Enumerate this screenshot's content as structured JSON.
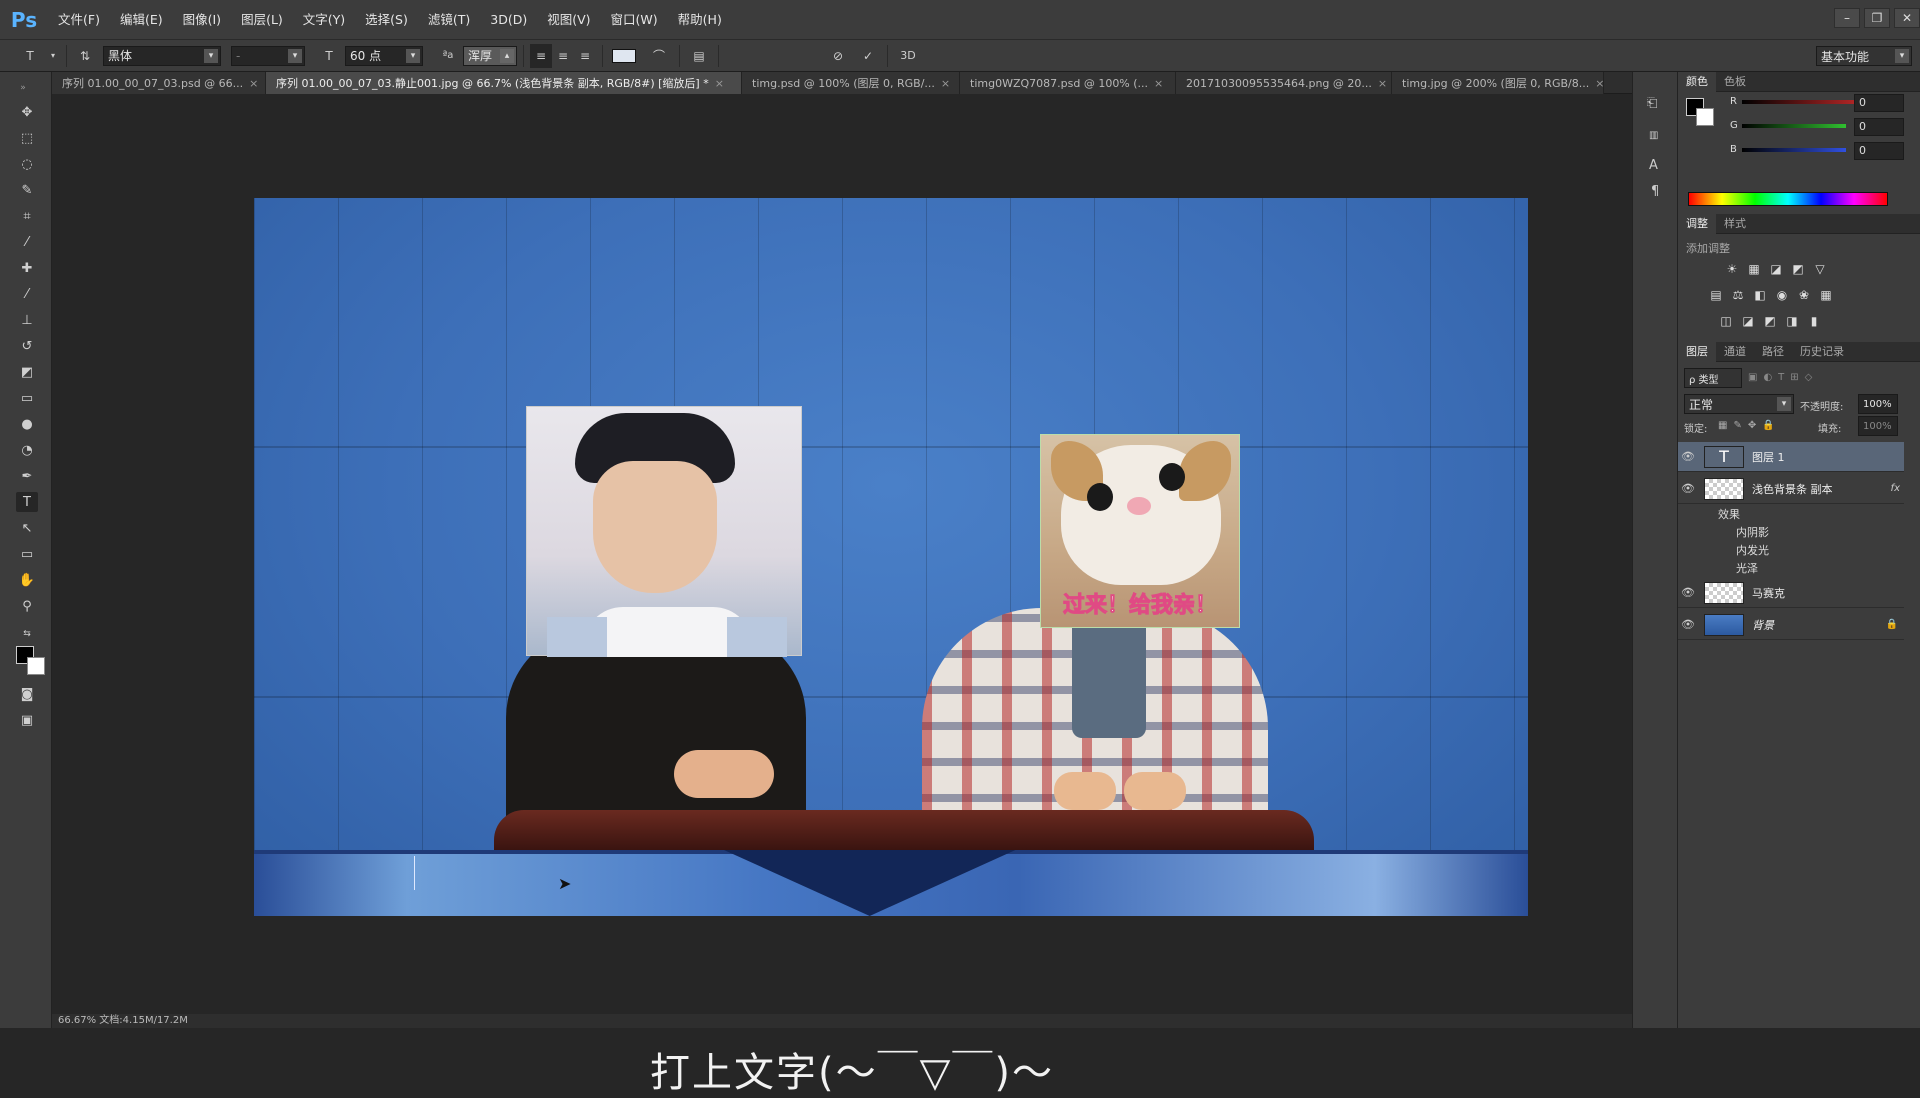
{
  "app": {
    "logo": "Ps"
  },
  "menu": [
    "文件(F)",
    "编辑(E)",
    "图像(I)",
    "图层(L)",
    "文字(Y)",
    "选择(S)",
    "滤镜(T)",
    "3D(D)",
    "视图(V)",
    "窗口(W)",
    "帮助(H)"
  ],
  "window_controls": [
    "–",
    "❐",
    "✕"
  ],
  "options": {
    "font_family": "黑体",
    "font_style": "-",
    "font_size": "60 点",
    "aa_icon": "ªa",
    "antialias": "浑厚",
    "workspace": "基本功能",
    "threed": "3D"
  },
  "tabs": [
    {
      "label": "序列 01.00_00_07_03.psd @ 66...",
      "active": false
    },
    {
      "label": "序列 01.00_00_07_03.静止001.jpg @ 66.7% (浅色背景条 副本, RGB/8#) [缩放后] *",
      "active": true
    },
    {
      "label": "timg.psd @ 100% (图层 0, RGB/...",
      "active": false
    },
    {
      "label": "timg0WZQ7087.psd @ 100% (...",
      "active": false
    },
    {
      "label": "20171030095535464.png @ 20...",
      "active": false
    },
    {
      "label": "timg.jpg @ 200% (图层 0, RGB/8...",
      "active": false
    }
  ],
  "tab_close": "×",
  "canvas": {
    "cat_caption": "过来！给我亲！",
    "subtitle": "打上文字(～￣▽￣)～"
  },
  "color_panel": {
    "tabs": [
      "颜色",
      "色板"
    ],
    "r_label": "R",
    "g_label": "G",
    "b_label": "B",
    "r": "0",
    "g": "0",
    "b": "0",
    "channel_colors": {
      "r": "#e03030",
      "g": "#30c030",
      "b": "#3050e0"
    }
  },
  "adjust_panel": {
    "tabs": [
      "调整",
      "样式"
    ],
    "title": "添加调整"
  },
  "layers_panel": {
    "tabs": [
      "图层",
      "通道",
      "路径",
      "历史记录"
    ],
    "filter_label": "ρ 类型",
    "blend_mode": "正常",
    "opacity_label": "不透明度:",
    "opacity": "100%",
    "lock_label": "锁定:",
    "fill_label": "填充:",
    "fill": "100%",
    "layers": [
      {
        "name": "图层 1",
        "selected": true,
        "thumb": "text-icon"
      },
      {
        "name": "浅色背景条 副本",
        "selected": false,
        "thumb": "checker",
        "fx": "fx"
      },
      {
        "name": "马赛克",
        "selected": false,
        "thumb": "checker"
      },
      {
        "name": "背景",
        "selected": false,
        "thumb": "photo",
        "locked": true
      }
    ],
    "effects_label": "效果",
    "effects": [
      "内阴影",
      "内发光",
      "光泽"
    ]
  },
  "status": "66.67%   文档:4.15M/17.2M"
}
